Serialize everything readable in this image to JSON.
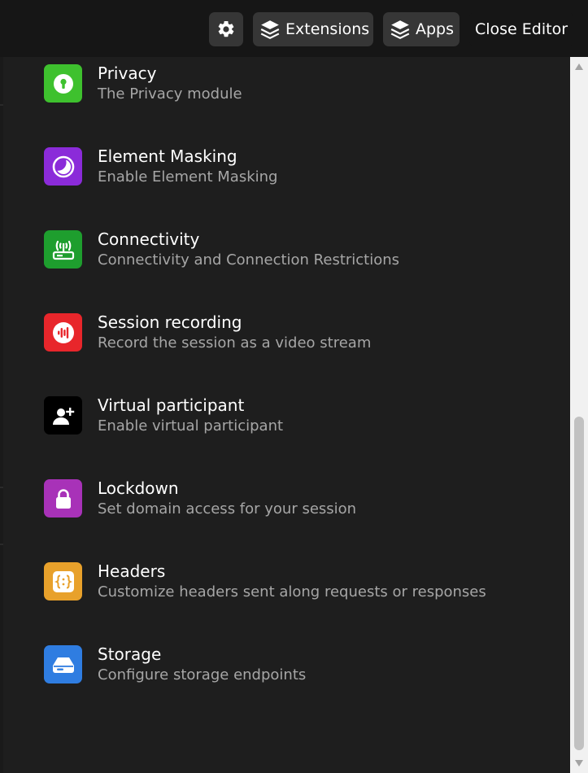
{
  "toolbar": {
    "settings_icon": "gear-icon",
    "extensions_label": "Extensions",
    "extensions_icon": "layers-icon",
    "apps_label": "Apps",
    "apps_icon": "layers-icon",
    "close_label": "Close Editor"
  },
  "modules": [
    {
      "title": "Privacy",
      "description": "The Privacy module",
      "icon": "keyhole-icon",
      "color": "#3ec12e"
    },
    {
      "title": "Element Masking",
      "description": "Enable Element Masking",
      "icon": "moon-icon",
      "color": "#8b2bd9"
    },
    {
      "title": "Connectivity",
      "description": "Connectivity and Connection Restrictions",
      "icon": "router-icon",
      "color": "#1e9e2e"
    },
    {
      "title": "Session recording",
      "description": "Record the session as a video stream",
      "icon": "audio-wave-icon",
      "color": "#e8262b"
    },
    {
      "title": "Virtual participant",
      "description": "Enable virtual participant",
      "icon": "add-user-icon",
      "color": "#000000"
    },
    {
      "title": "Lockdown",
      "description": "Set domain access for your session",
      "icon": "lock-icon",
      "color": "#a832b8"
    },
    {
      "title": "Headers",
      "description": "Customize headers sent along requests or responses",
      "icon": "braces-icon",
      "color": "#e8a12b"
    },
    {
      "title": "Storage",
      "description": "Configure storage endpoints",
      "icon": "drive-icon",
      "color": "#2f7de1"
    }
  ],
  "colors": {
    "background": "#1e1e1e",
    "toolbar": "#161616",
    "button": "#363636",
    "description_text": "#a6a6a6"
  }
}
